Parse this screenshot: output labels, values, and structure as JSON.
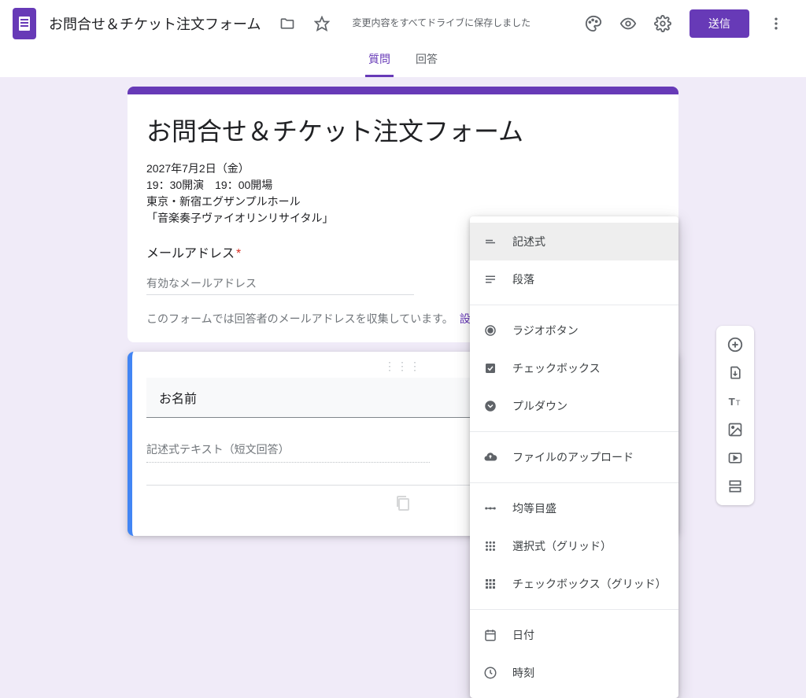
{
  "header": {
    "doc_title": "お問合せ＆チケット注文フォーム",
    "save_status": "変更内容をすべてドライブに保存しました",
    "send_label": "送信",
    "tabs": {
      "questions": "質問",
      "responses": "回答"
    }
  },
  "form": {
    "title": "お問合せ＆チケット注文フォーム",
    "desc_line1": "2027年7月2日（金）",
    "desc_line2": "19：30開演　19：00開場",
    "desc_line3": "東京・新宿エグザンプルホール",
    "desc_line4": "「音楽奏子ヴァイオリンリサイタル」",
    "email_label": "メールアドレス",
    "required_mark": "*",
    "email_placeholder": "有効なメールアドレス",
    "email_note": "このフォームでは回答者のメールアドレスを収集しています。",
    "email_settings": "設定"
  },
  "question": {
    "title": "お名前",
    "answer_placeholder": "記述式テキスト（短文回答）"
  },
  "popover": {
    "short_answer": "記述式",
    "paragraph": "段落",
    "multiple_choice": "ラジオボタン",
    "checkboxes": "チェックボックス",
    "dropdown": "プルダウン",
    "file_upload": "ファイルのアップロード",
    "linear_scale": "均等目盛",
    "mc_grid": "選択式（グリッド）",
    "checkbox_grid": "チェックボックス（グリッド）",
    "date": "日付",
    "time": "時刻"
  }
}
